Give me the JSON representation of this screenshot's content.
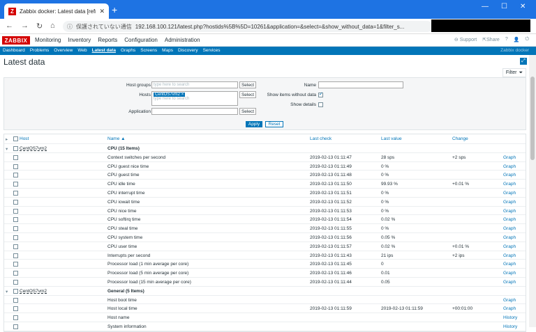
{
  "browser": {
    "tab_title": "Zabbix docker: Latest data [refr",
    "url_warning": "保護されていない通信",
    "url": "192.168.100.121/latest.php?hostids%5B%5D=10261&application=&select=&show_without_data=1&filter_s..."
  },
  "topnav": {
    "logo": "ZABBIX",
    "menu": [
      "Monitoring",
      "Inventory",
      "Reports",
      "Configuration",
      "Administration"
    ],
    "support": "Support",
    "share": "Share",
    "help": "?"
  },
  "subnav": {
    "items": [
      "Dashboard",
      "Problems",
      "Overview",
      "Web",
      "Latest data",
      "Graphs",
      "Screens",
      "Maps",
      "Discovery",
      "Services"
    ],
    "server": "Zabbix docker"
  },
  "page": {
    "title": "Latest data",
    "filter_label": "Filter"
  },
  "filter": {
    "host_groups_label": "Host groups",
    "host_groups_placeholder": "type here to search",
    "hosts_label": "Hosts",
    "hosts_tag": "CentOS7vm2",
    "hosts_placeholder": "type here to search",
    "application_label": "Application",
    "select_label": "Select",
    "name_label": "Name",
    "show_without_data_label": "Show items without data",
    "show_details_label": "Show details",
    "apply": "Apply",
    "reset": "Reset"
  },
  "table": {
    "headers": {
      "host": "Host",
      "name": "Name ▲",
      "last_check": "Last check",
      "last_value": "Last value",
      "change": "Change"
    },
    "rows": [
      {
        "type": "group",
        "host": "CentOS7vm2",
        "name": "CPU (15 Items)"
      },
      {
        "name": "Context switches per second",
        "last": "2019-02-13 01:11:47",
        "value": "28 sps",
        "change": "+2 sps",
        "action": "Graph"
      },
      {
        "name": "CPU guest nice time",
        "last": "2019-02-13 01:11:49",
        "value": "0 %",
        "change": "",
        "action": "Graph"
      },
      {
        "name": "CPU guest time",
        "last": "2019-02-13 01:11:48",
        "value": "0 %",
        "change": "",
        "action": "Graph"
      },
      {
        "name": "CPU idle time",
        "last": "2019-02-13 01:11:50",
        "value": "99.93 %",
        "change": "+0.01 %",
        "action": "Graph"
      },
      {
        "name": "CPU interrupt time",
        "last": "2019-02-13 01:11:51",
        "value": "0 %",
        "change": "",
        "action": "Graph"
      },
      {
        "name": "CPU iowait time",
        "last": "2019-02-13 01:11:52",
        "value": "0 %",
        "change": "",
        "action": "Graph"
      },
      {
        "name": "CPU nice time",
        "last": "2019-02-13 01:11:53",
        "value": "0 %",
        "change": "",
        "action": "Graph"
      },
      {
        "name": "CPU softirq time",
        "last": "2019-02-13 01:11:54",
        "value": "0.02 %",
        "change": "",
        "action": "Graph"
      },
      {
        "name": "CPU steal time",
        "last": "2019-02-13 01:11:55",
        "value": "0 %",
        "change": "",
        "action": "Graph"
      },
      {
        "name": "CPU system time",
        "last": "2019-02-13 01:11:56",
        "value": "0.05 %",
        "change": "",
        "action": "Graph"
      },
      {
        "name": "CPU user time",
        "last": "2019-02-13 01:11:57",
        "value": "0.02 %",
        "change": "+0.01 %",
        "action": "Graph"
      },
      {
        "name": "Interrupts per second",
        "last": "2019-02-13 01:11:43",
        "value": "21 ips",
        "change": "+2 ips",
        "action": "Graph"
      },
      {
        "name": "Processor load (1 min average per core)",
        "last": "2019-02-13 01:11:45",
        "value": "0",
        "change": "",
        "action": "Graph"
      },
      {
        "name": "Processor load (5 min average per core)",
        "last": "2019-02-13 01:11:46",
        "value": "0.01",
        "change": "",
        "action": "Graph"
      },
      {
        "name": "Processor load (15 min average per core)",
        "last": "2019-02-13 01:11:44",
        "value": "0.05",
        "change": "",
        "action": "Graph"
      },
      {
        "type": "group",
        "host": "CentOS7vm2",
        "name": "General (5 Items)"
      },
      {
        "name": "Host boot time",
        "last": "",
        "value": "",
        "change": "",
        "action": "Graph"
      },
      {
        "name": "Host local time",
        "last": "2019-02-13 01:11:59",
        "value": "2019-02-13 01:11:59",
        "change": "+00:01:00",
        "action": "Graph"
      },
      {
        "name": "Host name",
        "last": "",
        "value": "",
        "change": "",
        "action": "History"
      },
      {
        "name": "System information",
        "last": "",
        "value": "",
        "change": "",
        "action": "History"
      }
    ]
  }
}
